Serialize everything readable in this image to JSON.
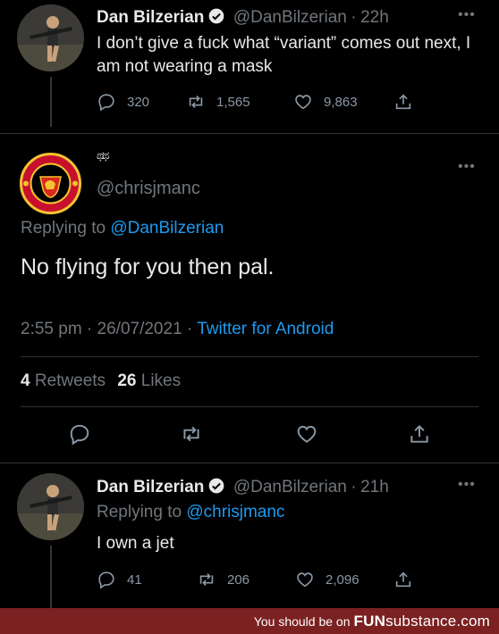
{
  "tweet1": {
    "name": "Dan Bilzerian",
    "handle": "@DanBilzerian",
    "sep": "·",
    "time": "22h",
    "text": "I don’t give a fuck what “variant” comes out next, I am not wearing a mask",
    "replies": "320",
    "retweets": "1,565",
    "likes": "9,863"
  },
  "tweet2": {
    "display_name": "ಥ ಥ",
    "handle": "@chrisjmanc",
    "replying_prefix": "Replying to",
    "replying_to": "@DanBilzerian",
    "text": "No flying for you then pal.",
    "timestamp": "2:55 pm · 26/07/2021 ·",
    "source": "Twitter for Android",
    "retweets_count": "4",
    "retweets_label": "Retweets",
    "likes_count": "26",
    "likes_label": "Likes"
  },
  "tweet3": {
    "name": "Dan Bilzerian",
    "handle": "@DanBilzerian",
    "sep": "·",
    "time": "21h",
    "replying_prefix": "Replying to",
    "replying_to": "@chrisjmanc",
    "text": "I own a jet",
    "replies": "41",
    "retweets": "206",
    "likes": "2,096"
  },
  "footer": {
    "tagline": "You should be on",
    "brand_bold": "FUN",
    "brand_rest": "substance",
    "brand_tld": ".com"
  },
  "colors": {
    "background": "#000000",
    "text": "#e7e9ea",
    "muted": "#71767b",
    "link": "#1d9bf0",
    "footer": "#7b2122"
  },
  "icons": [
    "reply-icon",
    "retweet-icon",
    "like-icon",
    "share-icon",
    "verified-icon",
    "more-icon"
  ]
}
